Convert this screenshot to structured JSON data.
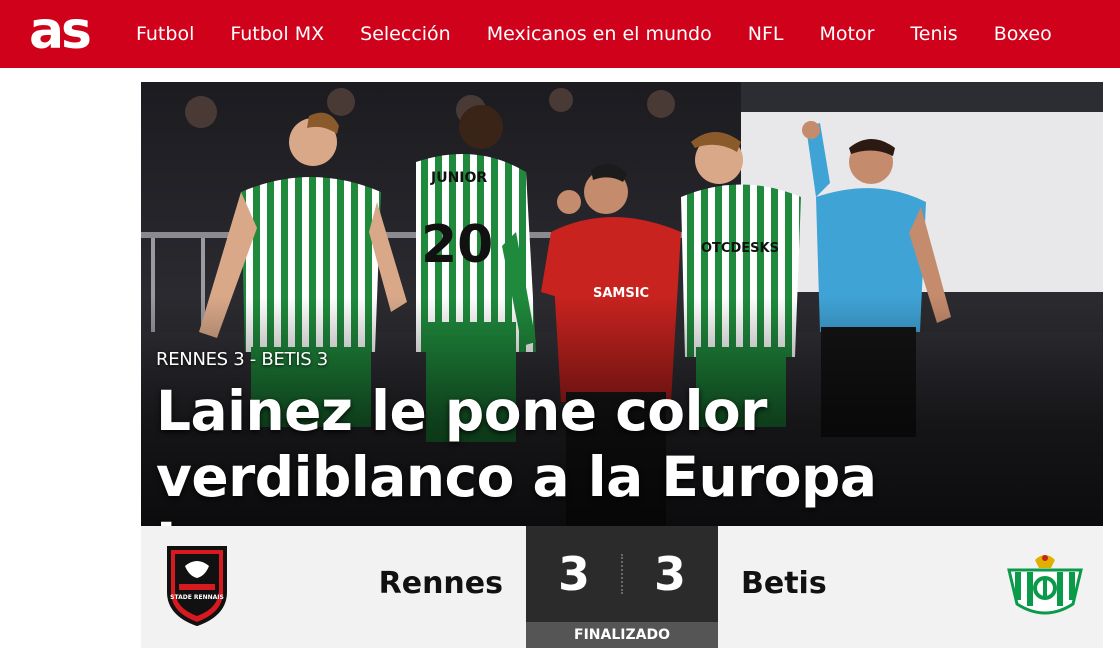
{
  "header": {
    "logo_text": "as",
    "logo_alt": "AS",
    "brand_color": "#d0021b",
    "nav": [
      {
        "label": "Futbol"
      },
      {
        "label": "Futbol MX"
      },
      {
        "label": "Selección"
      },
      {
        "label": "Mexicanos en el mundo"
      },
      {
        "label": "NFL"
      },
      {
        "label": "Motor"
      },
      {
        "label": "Tenis"
      },
      {
        "label": "Boxeo"
      }
    ]
  },
  "hero": {
    "kicker": "RENNES 3 - BETIS 3",
    "headline": "Lainez le pone color verdiblanco a la Europa League",
    "photo": "football-players-celebration-photo",
    "shirt_number": "20",
    "shirt_name": "JUNIOR",
    "sponsor_home": "SAMSIC",
    "sponsor_away": "OTCDESKS"
  },
  "match": {
    "home_team": "Rennes",
    "away_team": "Betis",
    "home_score": "3",
    "away_score": "3",
    "status": "FINALIZADO",
    "home_crest": "stade-rennais-crest-icon",
    "home_crest_text": "STADE RENNAIS",
    "away_crest": "real-betis-crest-icon",
    "colors": {
      "scorebox": "#2b2b2b",
      "status_bar": "#555555",
      "home": "#d71920",
      "away": "#0b9a4a"
    }
  }
}
